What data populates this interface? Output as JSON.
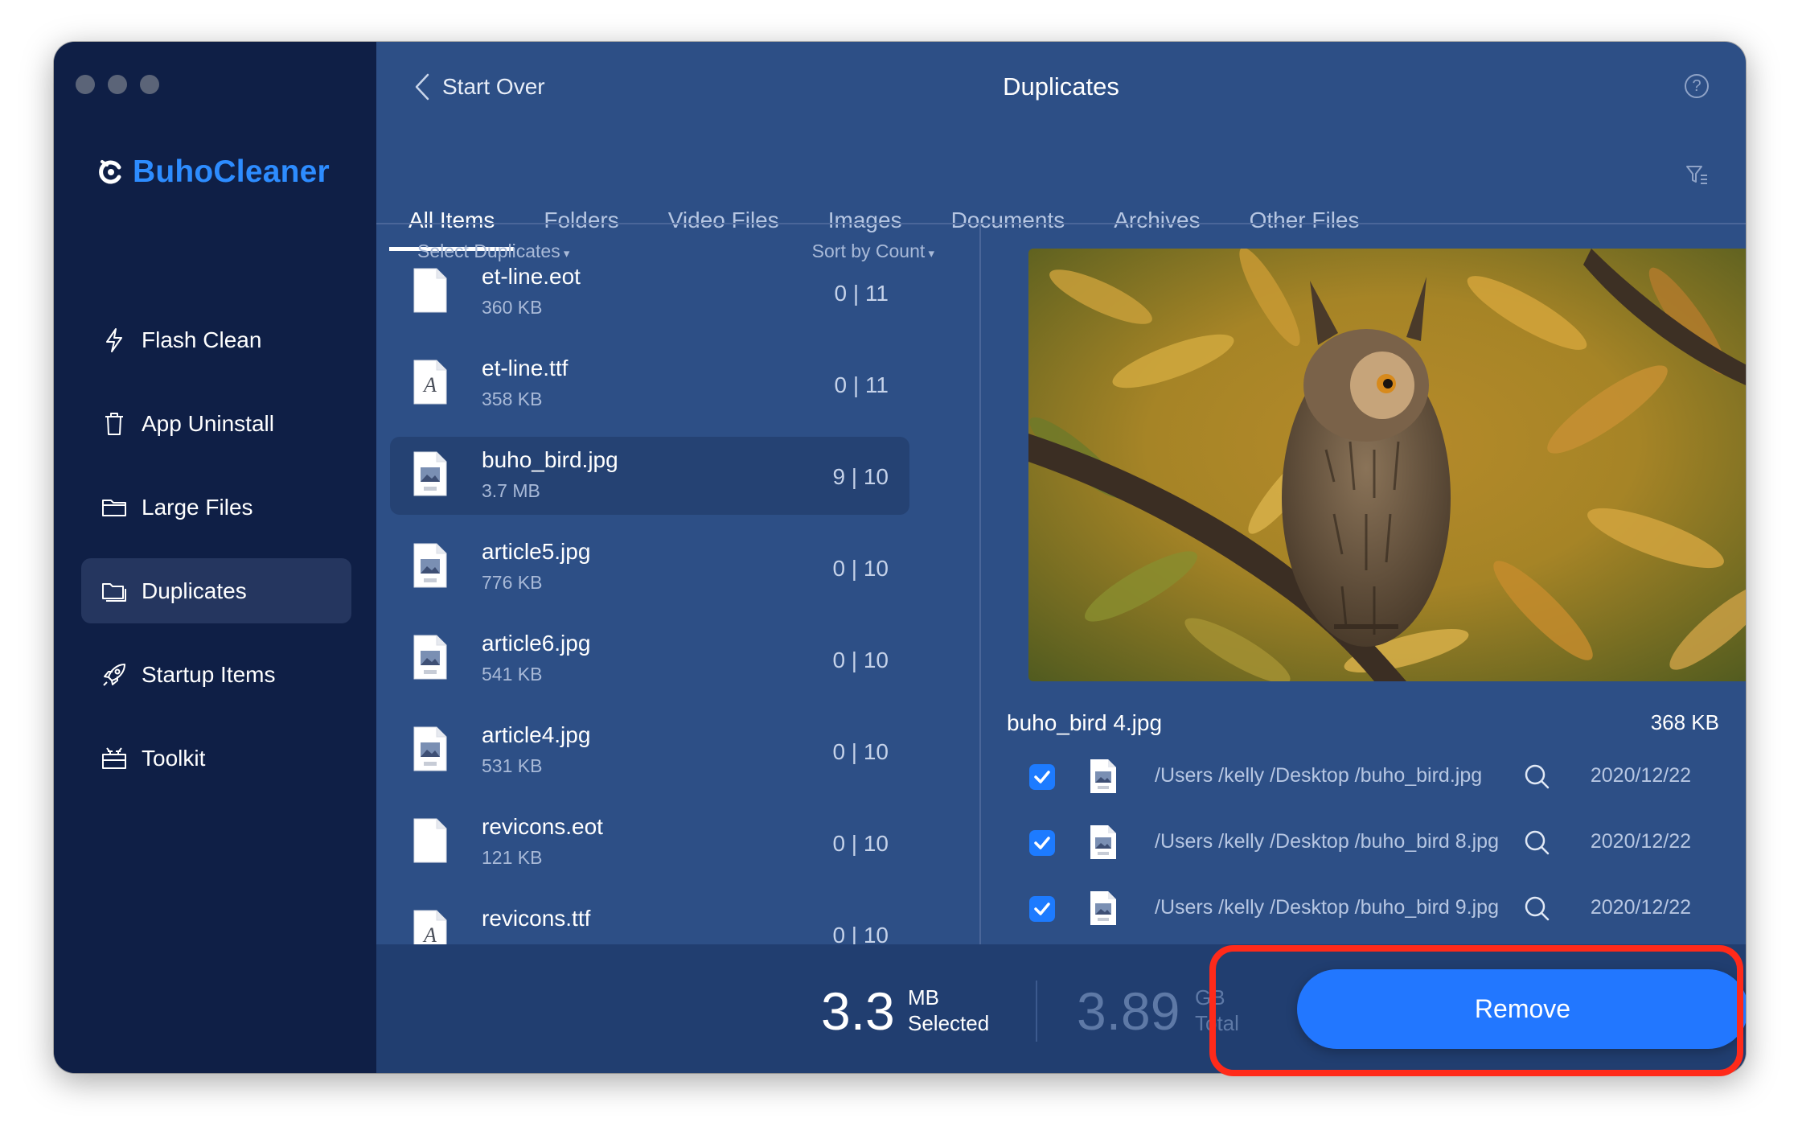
{
  "app": {
    "name": "BuhoCleaner"
  },
  "sidebar": {
    "items": [
      {
        "label": "Flash Clean",
        "icon": "lightning-icon"
      },
      {
        "label": "App Uninstall",
        "icon": "trash-icon"
      },
      {
        "label": "Large Files",
        "icon": "folder-icon"
      },
      {
        "label": "Duplicates",
        "icon": "duplicate-folder-icon",
        "active": true
      },
      {
        "label": "Startup Items",
        "icon": "rocket-icon"
      },
      {
        "label": "Toolkit",
        "icon": "toolbox-icon"
      }
    ]
  },
  "header": {
    "back_label": "Start Over",
    "title": "Duplicates"
  },
  "tabs": [
    "All Items",
    "Folders",
    "Video Files",
    "Images",
    "Documents",
    "Archives",
    "Other Files"
  ],
  "list": {
    "select_label": "Select Duplicates",
    "sort_label": "Sort by Count",
    "rows": [
      {
        "name": "et-line.eot",
        "size": "360 KB",
        "count": "0 | 11",
        "icon": "blank-file-icon"
      },
      {
        "name": "et-line.ttf",
        "size": "358 KB",
        "count": "0 | 11",
        "icon": "font-file-icon"
      },
      {
        "name": "buho_bird.jpg",
        "size": "3.7 MB",
        "count": "9 | 10",
        "icon": "image-file-icon",
        "active": true
      },
      {
        "name": "article5.jpg",
        "size": "776 KB",
        "count": "0 | 10",
        "icon": "image-file-icon"
      },
      {
        "name": "article6.jpg",
        "size": "541 KB",
        "count": "0 | 10",
        "icon": "image-file-icon"
      },
      {
        "name": "article4.jpg",
        "size": "531 KB",
        "count": "0 | 10",
        "icon": "image-file-icon"
      },
      {
        "name": "revicons.eot",
        "size": "121 KB",
        "count": "0 | 10",
        "icon": "blank-file-icon"
      },
      {
        "name": "revicons.ttf",
        "size": "",
        "count": "0 | 10",
        "icon": "font-file-icon"
      }
    ]
  },
  "preview": {
    "file_name": "buho_bird 4.jpg",
    "file_size": "368 KB",
    "duplicates": [
      {
        "path": "/Users /kelly /Desktop /buho_bird.jpg",
        "date": "2020/12/22",
        "checked": true
      },
      {
        "path": "/Users /kelly /Desktop /buho_bird 8.jpg",
        "date": "2020/12/22",
        "checked": true
      },
      {
        "path": "/Users /kelly /Desktop /buho_bird 9.jpg",
        "date": "2020/12/22",
        "checked": true
      }
    ]
  },
  "footer": {
    "selected_value": "3.3",
    "selected_unit": "MB",
    "selected_label": "Selected",
    "total_value": "3.89",
    "total_unit": "GB",
    "total_label": "Total",
    "remove_label": "Remove"
  },
  "colors": {
    "accent": "#2277ff",
    "brand": "#2d8cff",
    "sidebar": "#0f1f46",
    "main": "#2d4f86",
    "highlight": "#ff2a1a"
  }
}
